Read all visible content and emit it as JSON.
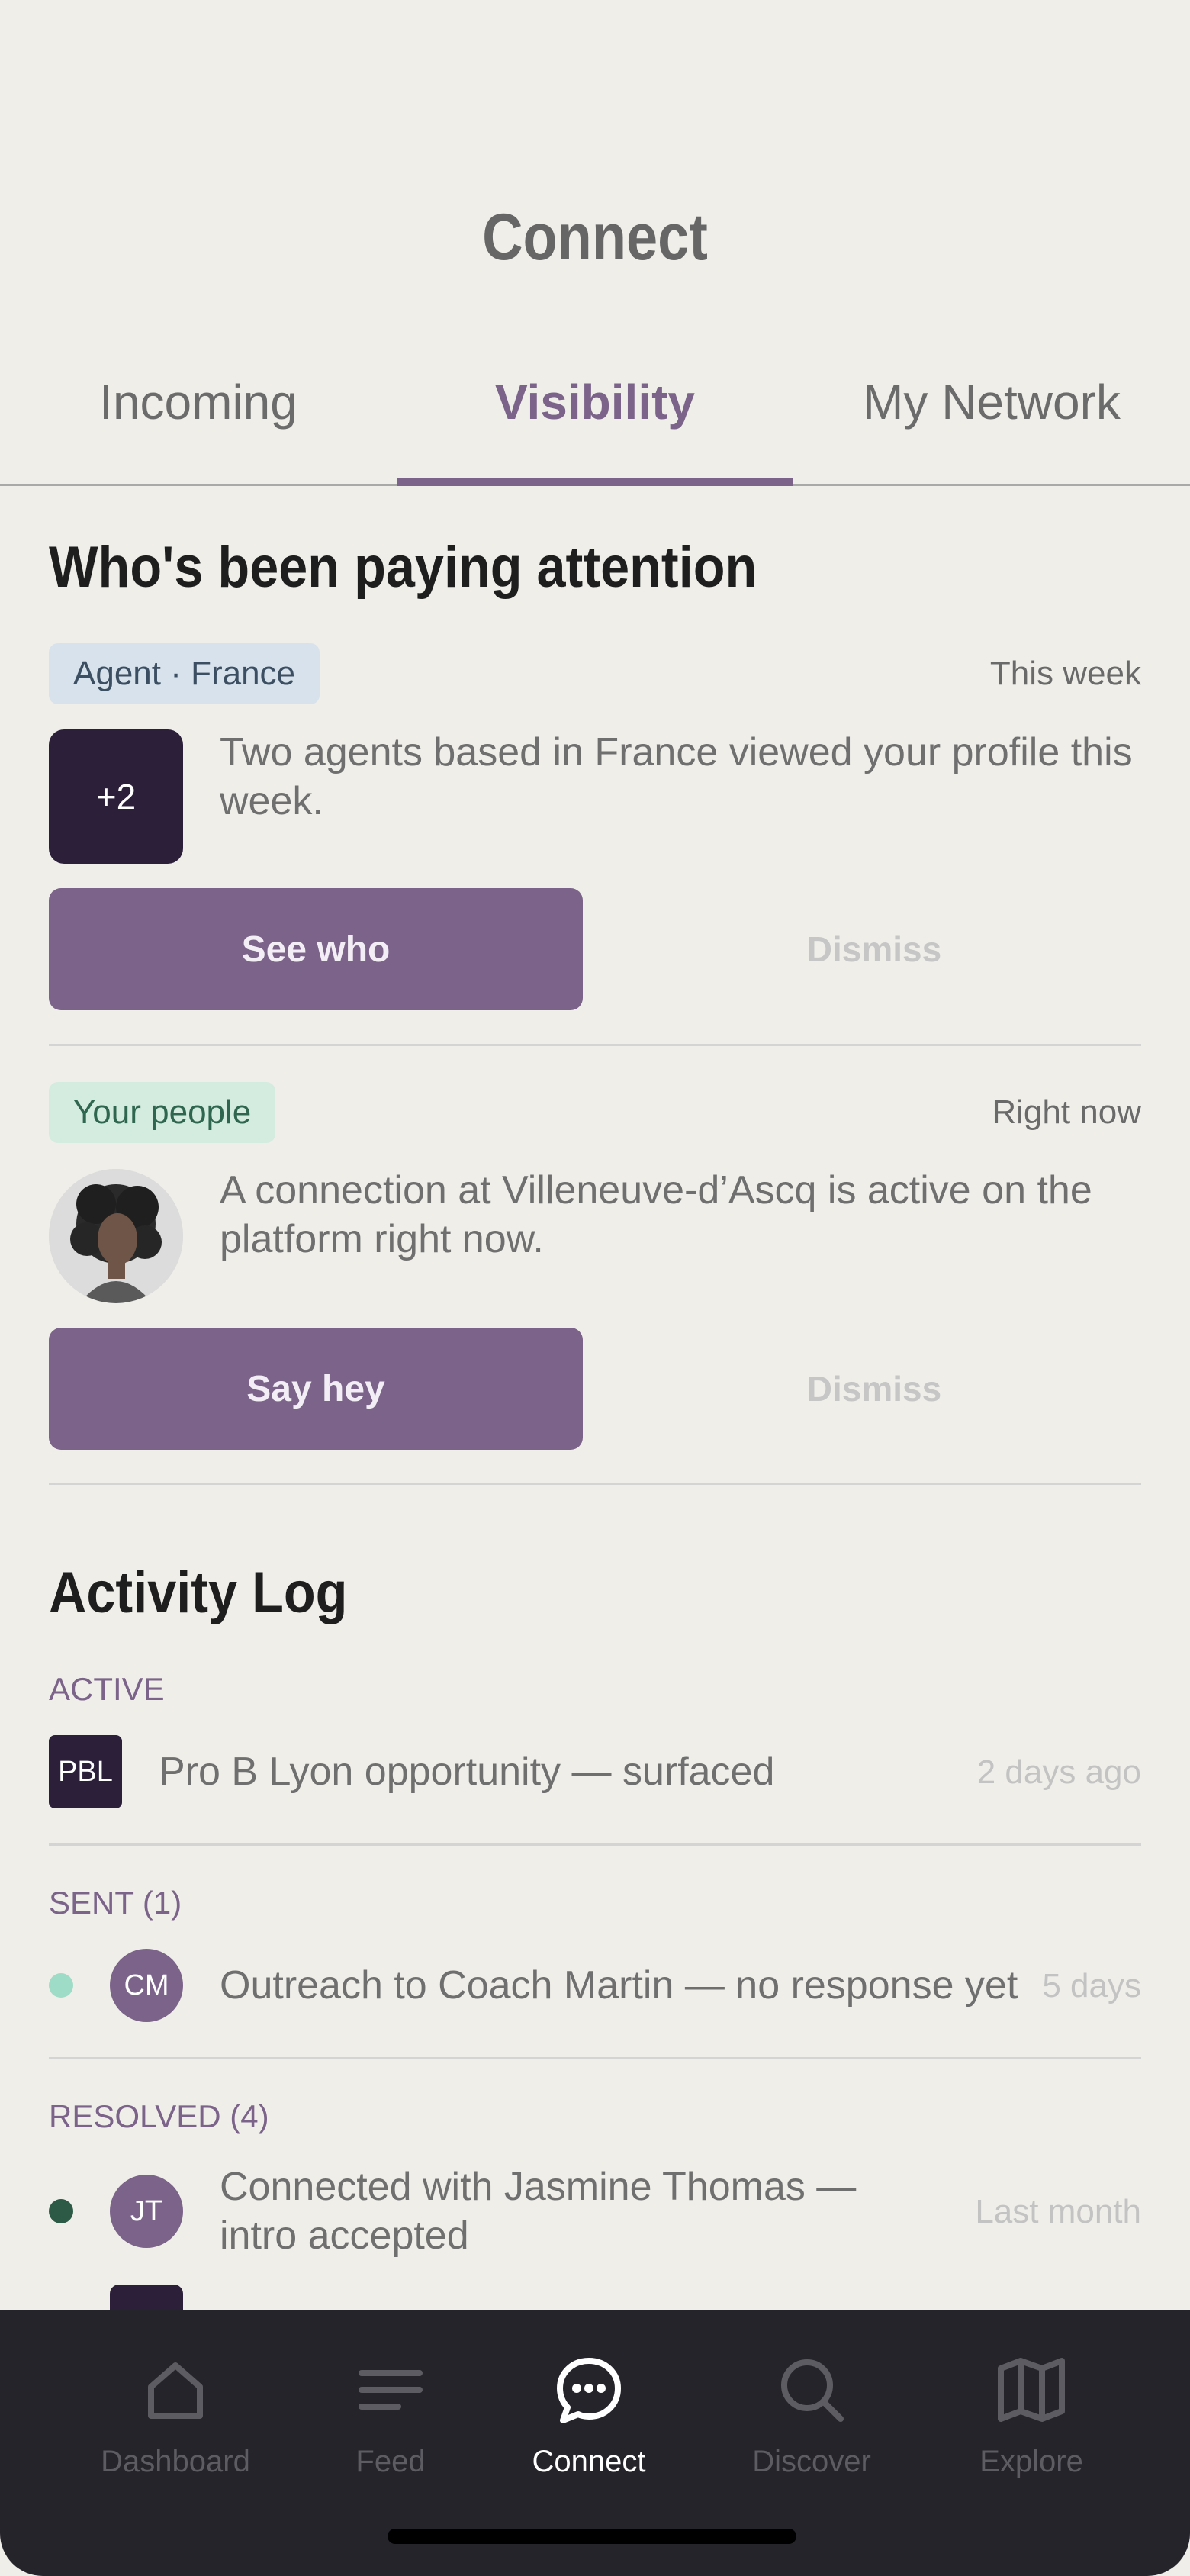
{
  "header": {
    "title": "Connect"
  },
  "tabs": [
    {
      "label": "Incoming",
      "active": false
    },
    {
      "label": "Visibility",
      "active": true
    },
    {
      "label": "My Network",
      "active": false
    }
  ],
  "attention": {
    "heading": "Who's been paying attention",
    "cards": [
      {
        "badge": "Agent · France",
        "when": "This week",
        "avatar_text": "+2",
        "message": "Two agents based in France viewed your profile this week.",
        "primary_label": "See who",
        "dismiss_label": "Dismiss"
      },
      {
        "badge": "Your people",
        "when": "Right now",
        "message": "A connection at Villeneuve-d’Ascq is active on the platform right now.",
        "primary_label": "Say hey",
        "dismiss_label": "Dismiss"
      }
    ]
  },
  "activity": {
    "heading": "Activity Log",
    "groups": [
      {
        "label": "ACTIVE",
        "items": [
          {
            "icon_text": "PBL",
            "text": "Pro B Lyon opportunity — surfaced",
            "time": "2 days ago"
          }
        ]
      },
      {
        "label": "SENT (1)",
        "items": [
          {
            "dot_color": "#9fdcc7",
            "icon_text": "CM",
            "text": "Outreach to Coach Martin — no response yet",
            "time": "5 days"
          }
        ]
      },
      {
        "label": "RESOLVED (4)",
        "items": [
          {
            "dot_color": "#2d5a47",
            "icon_text": "JT",
            "text": "Connected with Jasmine Thomas — intro accepted",
            "time": "Last month"
          }
        ]
      }
    ]
  },
  "nav": {
    "items": [
      {
        "label": "Dashboard",
        "icon": "home-icon"
      },
      {
        "label": "Feed",
        "icon": "feed-icon"
      },
      {
        "label": "Connect",
        "icon": "chat-bubble-icon",
        "active": true
      },
      {
        "label": "Discover",
        "icon": "search-icon"
      },
      {
        "label": "Explore",
        "icon": "map-icon"
      }
    ]
  },
  "colors": {
    "accent": "#7b6389",
    "dark": "#2c1f3a",
    "nav_bg": "#26242b",
    "background": "#efeee9"
  }
}
